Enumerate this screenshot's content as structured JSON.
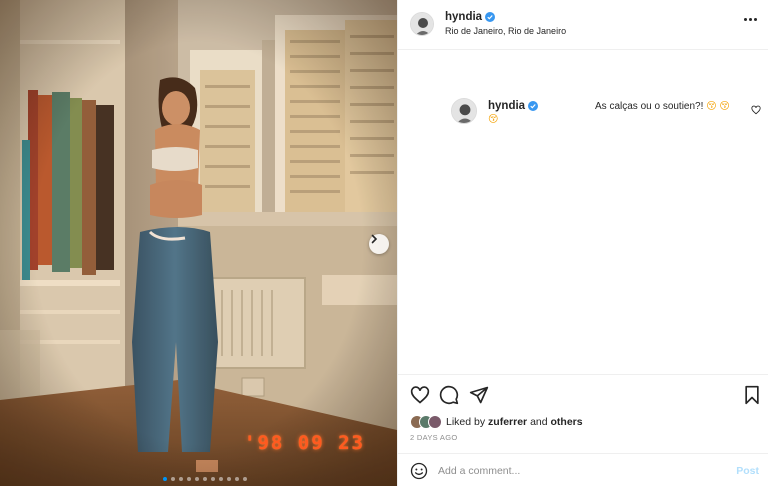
{
  "post": {
    "username": "hyndia",
    "location": "Rio de Janeiro, Rio de Janeiro",
    "date_stamp": "'98 09 23",
    "carousel_count": 11,
    "carousel_active": 1
  },
  "caption": {
    "username": "hyndia",
    "text": "As calças ou o soutien?!",
    "emoji_inline": "😚 😚",
    "emoji_second_line": "😚"
  },
  "likes": {
    "liked_by_prefix": "Liked by",
    "liked_by_user": "zuferrer",
    "and": "and",
    "others": "others"
  },
  "timestamp": "2 DAYS AGO",
  "comment": {
    "placeholder": "Add a comment...",
    "post_label": "Post"
  },
  "colors": {
    "verified": "#3897f0",
    "post_disabled": "#b2dffc",
    "stamp": "#ff5a1f"
  },
  "icons": [
    "verified-badge-icon",
    "more-icon",
    "heart-icon",
    "comment-icon",
    "share-icon",
    "bookmark-icon",
    "emoji-icon",
    "chevron-right-icon"
  ]
}
